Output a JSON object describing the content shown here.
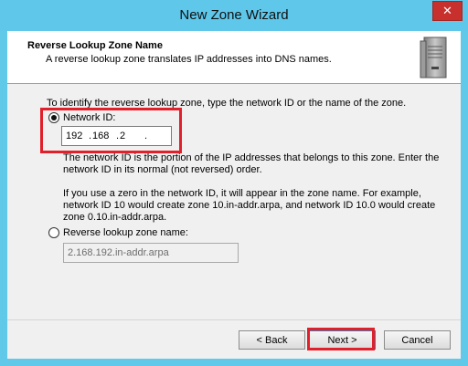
{
  "window": {
    "title": "New Zone Wizard",
    "close_glyph": "✕"
  },
  "header": {
    "title": "Reverse Lookup Zone Name",
    "subtitle": "A reverse lookup zone translates IP addresses into DNS names.",
    "icon": "server-icon"
  },
  "body": {
    "intro": "To identify the reverse lookup zone, type the network ID or the name of the zone.",
    "network_id": {
      "label": "Network ID:",
      "selected": true,
      "octets": [
        "192",
        "168",
        "2",
        ""
      ]
    },
    "paragraph1_line1": "The network ID is the portion of the IP addresses that belongs to this zone. Enter the",
    "paragraph1_line2": "network ID in its normal (not reversed) order.",
    "paragraph2_line1": "If you use a zero in the network ID, it will appear in the zone name. For example,",
    "paragraph2_line2": "network ID 10 would create zone 10.in-addr.arpa, and network ID 10.0 would create",
    "paragraph2_line3": "zone 0.10.in-addr.arpa.",
    "reverse_zone": {
      "label": "Reverse lookup zone name:",
      "selected": false,
      "value": "2.168.192.in-addr.arpa"
    }
  },
  "buttons": {
    "back": "< Back",
    "next": "Next >",
    "cancel": "Cancel"
  },
  "colors": {
    "titlebar": "#5ec7ea",
    "close": "#c7302d",
    "highlight": "#e0202a"
  }
}
